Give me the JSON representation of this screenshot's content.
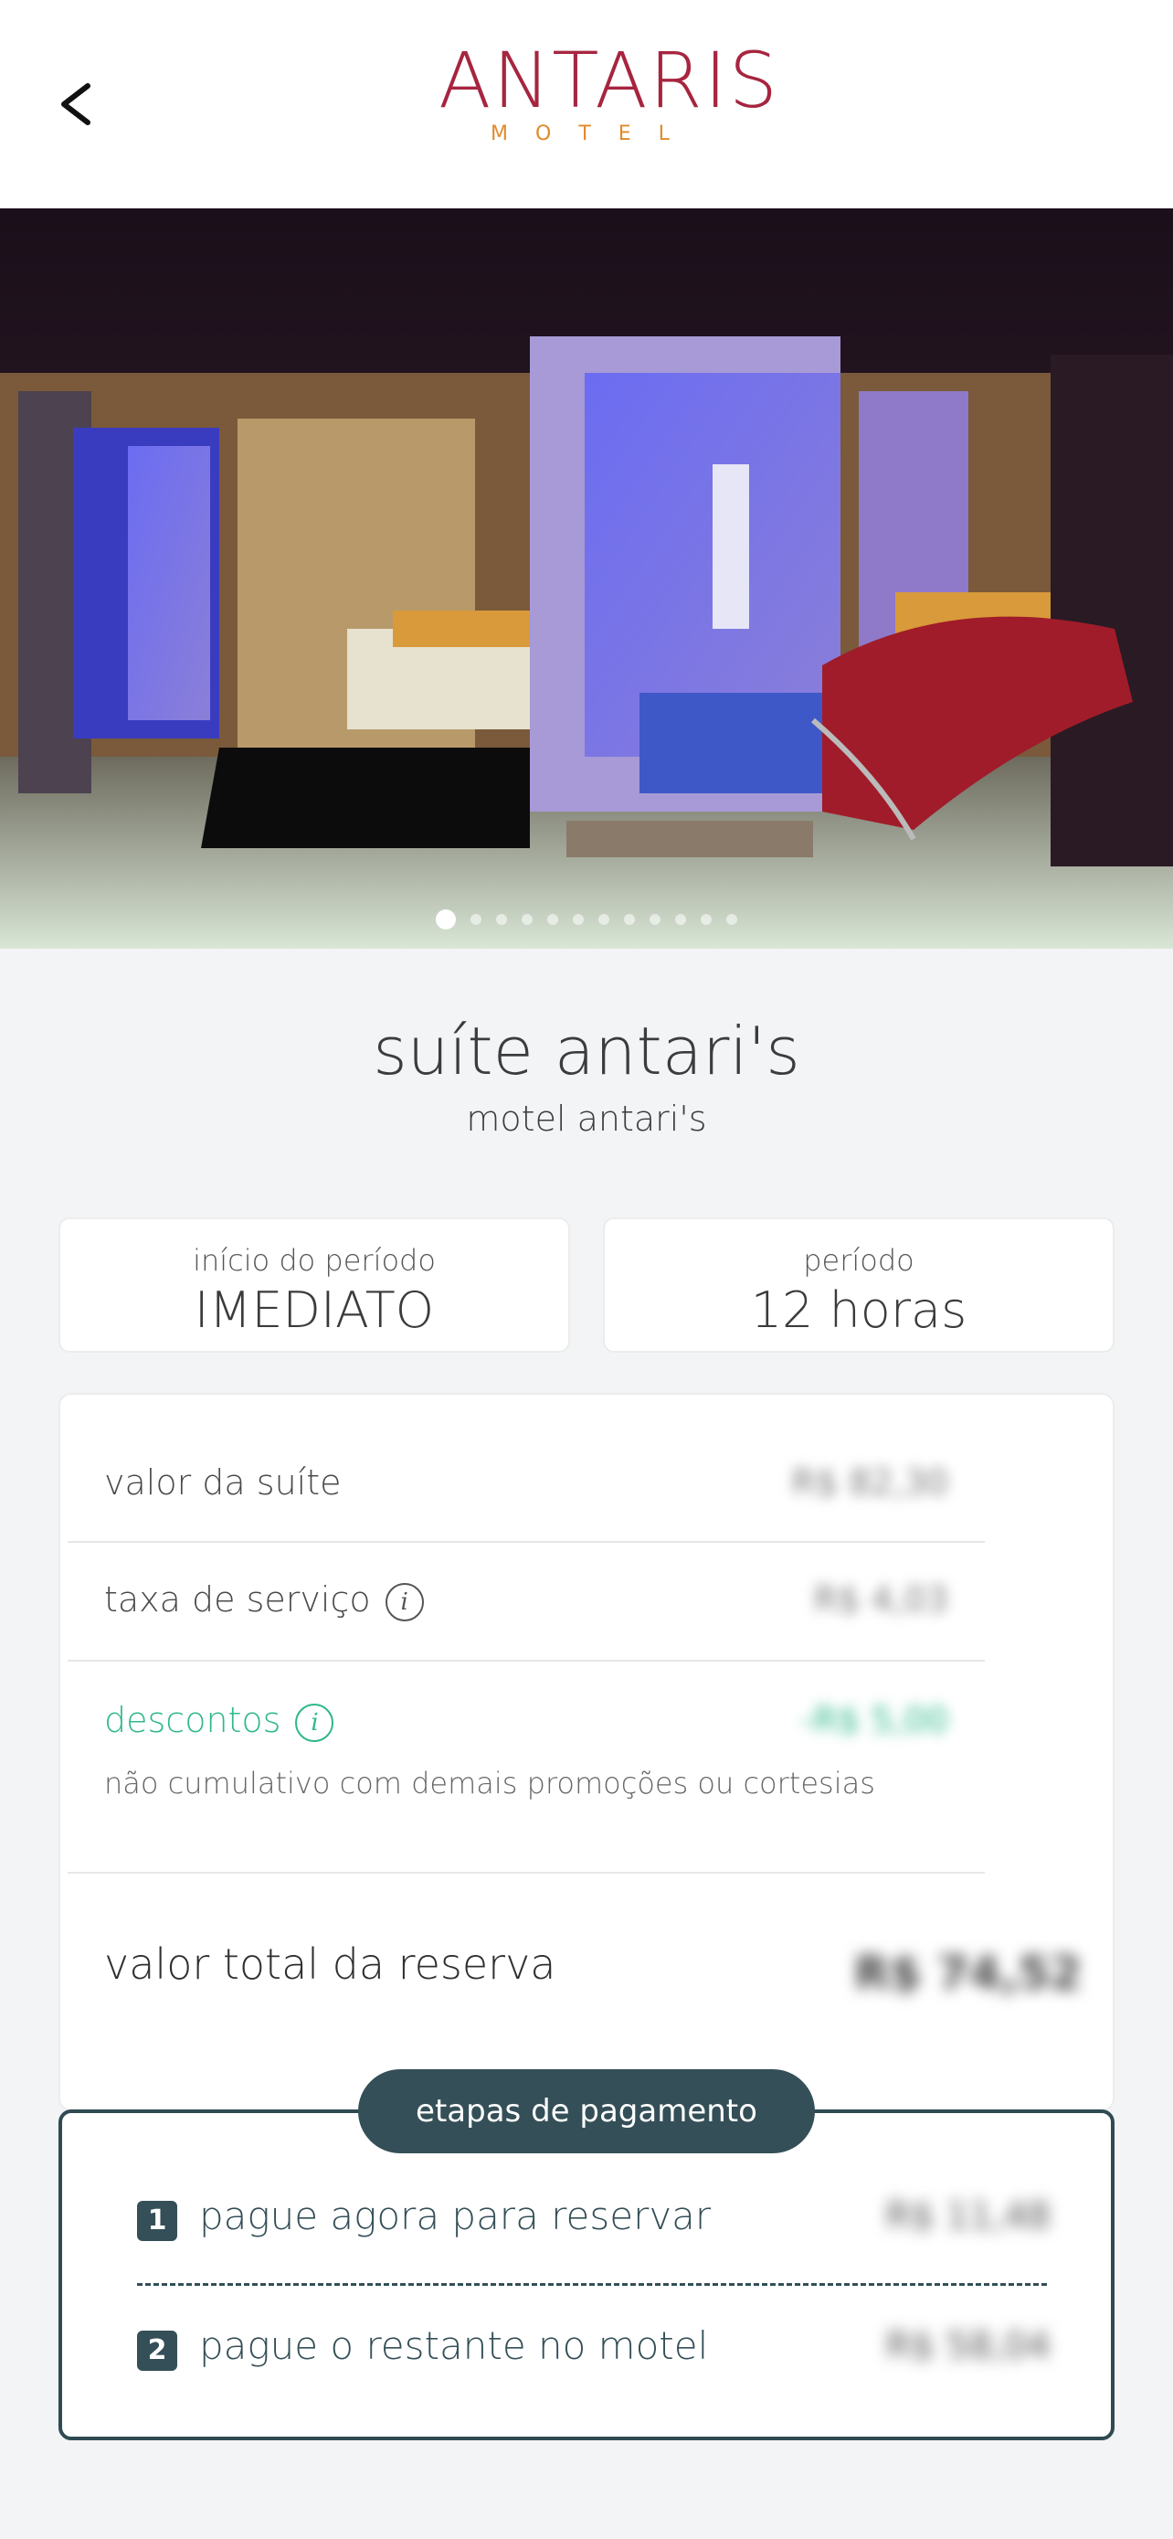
{
  "header": {
    "back_icon": "chevron-left-icon",
    "logo": {
      "main": "ANTARIS",
      "sub": "MOTEL"
    }
  },
  "gallery": {
    "slide_count": 12,
    "active_index": 0
  },
  "suite": {
    "title": "suíte antari's",
    "motel": "motel antari's"
  },
  "period_start": {
    "label": "início do período",
    "value": "IMEDIATO"
  },
  "period": {
    "label": "período",
    "value": "12 horas"
  },
  "pricing": {
    "suite_value": {
      "label": "valor da suíte",
      "value": "R$ 82,30"
    },
    "service_fee": {
      "label": "taxa de serviço",
      "value": "R$ 4,03"
    },
    "discounts": {
      "label": "descontos",
      "value": "-R$ 5,00",
      "note": "não cumulativo com demais promoções ou cortesias"
    },
    "total": {
      "label": "valor total da reserva",
      "value": "R$ 74,52"
    }
  },
  "payment_steps": {
    "title": "etapas de pagamento",
    "steps": [
      {
        "number": "1",
        "label": "pague agora para reservar",
        "value": "R$ 11,48"
      },
      {
        "number": "2",
        "label": "pague o restante no motel",
        "value": "R$ 58,04"
      }
    ]
  },
  "colors": {
    "brand": "#a6253f",
    "accent": "#e08a2d",
    "discount": "#2fb889",
    "dark": "#344f57"
  }
}
